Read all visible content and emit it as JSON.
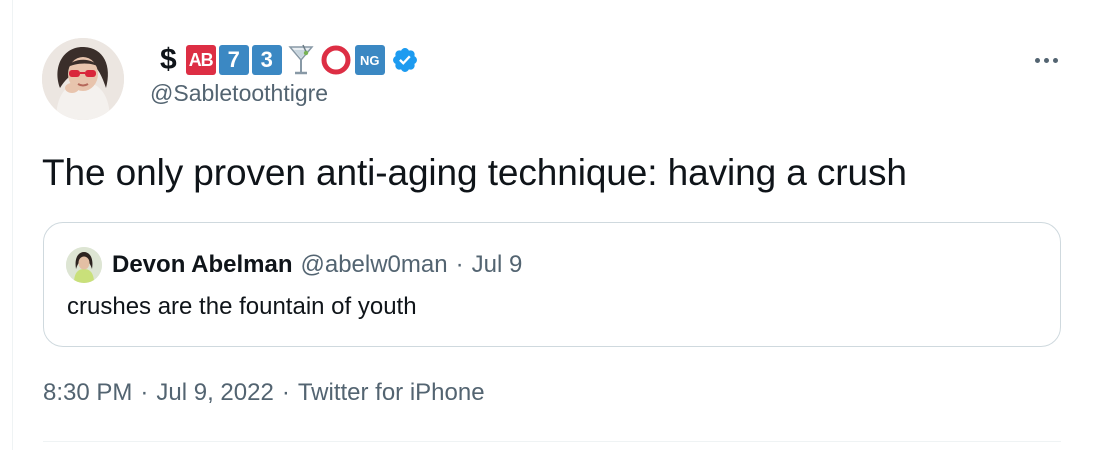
{
  "author": {
    "display_name_prefix": "$",
    "name_badges": {
      "ab": "AB",
      "seven": "7",
      "three": "3",
      "ng": "NG"
    },
    "name_icons": [
      "dollar",
      "ab-blood-type-button",
      "keycap-7",
      "keycap-3",
      "cocktail-glass-icon",
      "hollow-red-circle-icon",
      "ng-button",
      "verified-badge-icon"
    ],
    "handle": "@Sabletoothtigre",
    "verified_color": "#1d9bf0"
  },
  "tweet": {
    "text": "The only proven anti-aging technique: having a crush"
  },
  "quoted_tweet": {
    "name": "Devon Abelman",
    "handle": "@abelw0man",
    "separator": "·",
    "date": "Jul 9",
    "text": "crushes are the fountain of youth"
  },
  "meta": {
    "time": "8:30 PM",
    "sep1": "·",
    "date": "Jul 9, 2022",
    "sep2": "·",
    "source": "Twitter for iPhone"
  },
  "colors": {
    "text_primary": "#0f1419",
    "text_secondary": "#536471",
    "border": "#cfd9de",
    "badge_red": "#dd2e44",
    "badge_blue": "#3b88c3"
  }
}
